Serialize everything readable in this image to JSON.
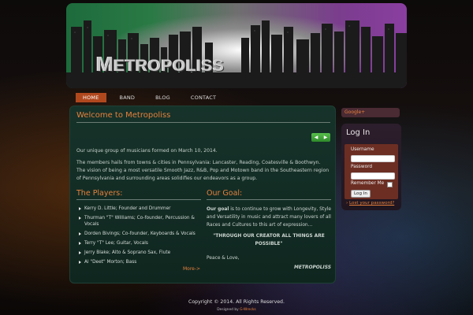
{
  "header": {
    "logo_first": "M",
    "logo_rest": "ETROPOLISS"
  },
  "nav": {
    "items": [
      "HOME",
      "BAND",
      "BLOG",
      "CONTACT"
    ],
    "active": "HOME"
  },
  "main": {
    "title": "Welcome to Metropoliss",
    "intro": "Our unique group of musicians formed on March 10, 2014.",
    "description": "The members hails from towns & cities in Pennsylvania: Lancaster, Reading, Coatesville & Boothwyn.  The vision of being a most versatile Smooth Jazz, R&B, Pop and Motown band in the Southeastern region of Pennsylvania and surrounding areas solidifies our endeavors as a group.",
    "players_heading": "The Players:",
    "players": [
      "Kerry D. Little; Founder and Drummer",
      "Thurman \"T\" Williams; Co-founder, Percussion & Vocals",
      "Dorden Bivings; Co-founder, Keyboards & Vocals",
      "Terry \"T\" Lee; Guitar, Vocals",
      "Jerry Blake; Alto & Soprano Sax, Flute",
      "Al \"Deet\" Morton; Bass"
    ],
    "more_link": "More->",
    "goal_heading": "Our Goal:",
    "goal_lead": "Our goal",
    "goal_text": " is to continue to grow with Longevity, Style and Versatility in music and attract many lovers of all Races and Cultures to this art of expression…",
    "quote": "\"THROUGH OUR CREATOR ALL THINGS ARE POSSIBLE\"",
    "signoff": "Peace & Love,",
    "signature": "METROPOLISS"
  },
  "sidebar": {
    "google_link": "Google+",
    "login_title": "Log In",
    "username_label": "Username",
    "password_label": "Password",
    "remember_label": "Remember Me",
    "login_button": "Log In",
    "lost_password": "Lost your password?"
  },
  "footer": {
    "copyright": "Copyright © 2014. All Rights Reserved.",
    "designed_by_prefix": "Designed by ",
    "designed_by_name": "G-Wrecks"
  },
  "colors": {
    "accent": "#e6803c",
    "nav_active": "#b0481e",
    "panel": "#16332a"
  }
}
